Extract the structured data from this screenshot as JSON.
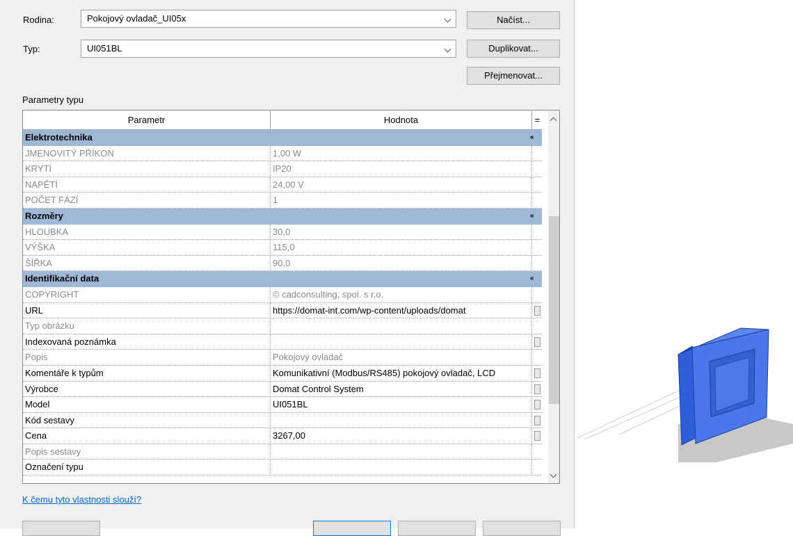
{
  "form": {
    "rodina_label": "Rodina:",
    "rodina_value": "Pokojový ovladač_UI05x",
    "typ_label": "Typ:",
    "typ_value": "UI051BL",
    "nacist_button": "Načíst...",
    "duplikovat_button": "Duplikovat...",
    "prejmenovat_button": "Přejmenovat...",
    "section_label": "Parametry typu"
  },
  "grid": {
    "header_param": "Parametr",
    "header_value": "Hodnota",
    "header_eq": "=",
    "group_collapse_glyph": "«",
    "groups": [
      {
        "title": "Elektrotechnika",
        "rows": [
          {
            "param": "JMENOVITÝ PŘÍKON",
            "value": "1,00 W",
            "grey": true,
            "mini": false
          },
          {
            "param": "KRYTÍ",
            "value": "IP20",
            "grey": true,
            "mini": false
          },
          {
            "param": "NAPĚTÍ",
            "value": "24,00 V",
            "grey": true,
            "mini": false
          },
          {
            "param": "POČET FÁZÍ",
            "value": "1",
            "grey": true,
            "mini": false
          }
        ]
      },
      {
        "title": "Rozměry",
        "rows": [
          {
            "param": "HLOUBKA",
            "value": "30,0",
            "grey": true,
            "mini": false
          },
          {
            "param": "VÝŠKA",
            "value": "115,0",
            "grey": true,
            "mini": false
          },
          {
            "param": "ŠÍŘKA",
            "value": "90,0",
            "grey": true,
            "mini": false
          }
        ]
      },
      {
        "title": "Identifikační data",
        "rows": [
          {
            "param": "COPYRIGHT",
            "value": "© cadconsulting, spol. s r.o.",
            "grey": true,
            "mini": false
          },
          {
            "param": "URL",
            "value": "https://domat-int.com/wp-content/uploads/domat",
            "grey": false,
            "mini": true
          },
          {
            "param": "Typ obrázku",
            "value": "",
            "grey": true,
            "mini": false
          },
          {
            "param": "Indexovaná poznámka",
            "value": "",
            "grey": false,
            "mini": true
          },
          {
            "param": "Popis",
            "value": "Pokojový ovladač",
            "grey": true,
            "mini": false
          },
          {
            "param": "Komentáře k typům",
            "value": "Komunikativní (Modbus/RS485) pokojový ovladač, LCD",
            "grey": false,
            "mini": true
          },
          {
            "param": "Výrobce",
            "value": "Domat Control System",
            "grey": false,
            "mini": true
          },
          {
            "param": "Model",
            "value": "UI051BL",
            "grey": false,
            "mini": true
          },
          {
            "param": "Kód sestavy",
            "value": "",
            "grey": false,
            "mini": true
          },
          {
            "param": "Cena",
            "value": "3267,00",
            "grey": false,
            "mini": true
          },
          {
            "param": "Popis sestavy",
            "value": "",
            "grey": true,
            "mini": false
          },
          {
            "param": "Označení typu",
            "value": "",
            "grey": false,
            "mini": false
          }
        ]
      }
    ]
  },
  "help_link": "K čemu tyto vlastnosti slouží?",
  "colors": {
    "group_bg": "#9fb8d6",
    "link": "#0066cc",
    "model_blue": "#3f6fe0"
  }
}
